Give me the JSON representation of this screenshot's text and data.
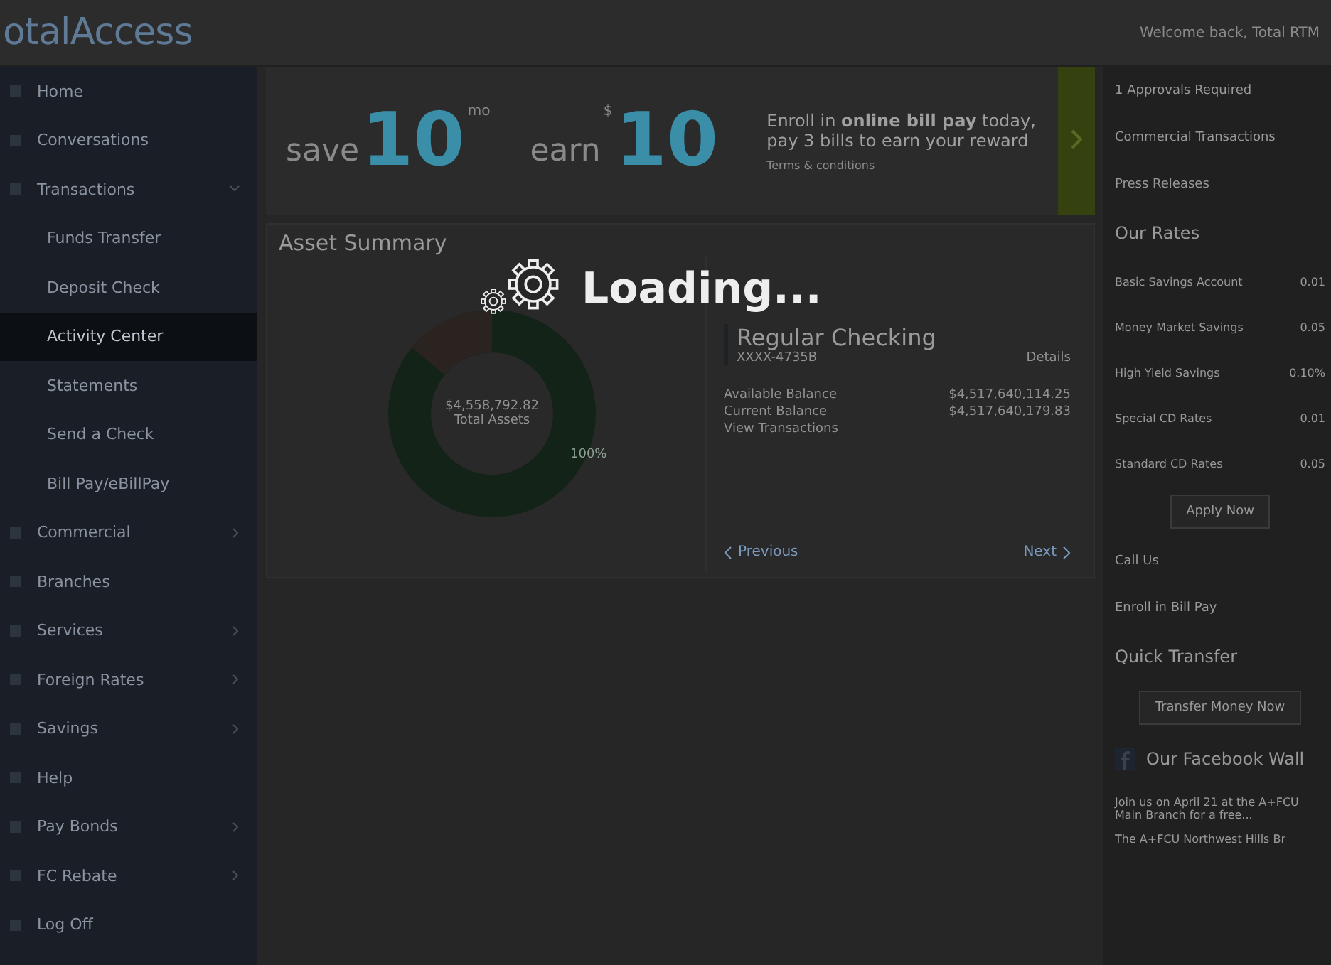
{
  "header": {
    "logo": "otalAccess",
    "welcome": "Welcome back, Total RTM"
  },
  "sidebar": {
    "items": [
      {
        "label": "Home",
        "kind": "top",
        "selected": false
      },
      {
        "label": "Conversations",
        "kind": "top",
        "selected": false
      },
      {
        "label": "Transactions",
        "kind": "group",
        "expanded": true,
        "selected": false
      },
      {
        "label": "Funds Transfer",
        "kind": "sub",
        "selected": false
      },
      {
        "label": "Deposit Check",
        "kind": "sub",
        "selected": false
      },
      {
        "label": "Activity Center",
        "kind": "sub",
        "selected": true
      },
      {
        "label": "Statements",
        "kind": "sub",
        "selected": false
      },
      {
        "label": "Send a Check",
        "kind": "sub",
        "selected": false
      },
      {
        "label": "Bill Pay/eBillPay",
        "kind": "sub",
        "selected": false
      },
      {
        "label": "Commercial",
        "kind": "group",
        "expanded": false,
        "selected": false
      },
      {
        "label": "Branches",
        "kind": "top",
        "selected": false
      },
      {
        "label": "Services",
        "kind": "group",
        "expanded": false,
        "selected": false
      },
      {
        "label": "Foreign Rates",
        "kind": "group",
        "expanded": false,
        "selected": false
      },
      {
        "label": "Savings",
        "kind": "group",
        "expanded": false,
        "selected": false
      },
      {
        "label": "Help",
        "kind": "top",
        "selected": false
      },
      {
        "label": "Pay Bonds",
        "kind": "group",
        "expanded": false,
        "selected": false
      },
      {
        "label": "FC Rebate",
        "kind": "group",
        "expanded": false,
        "selected": false
      },
      {
        "label": "Log Off",
        "kind": "top",
        "selected": false
      }
    ]
  },
  "banner": {
    "save_word": "save",
    "save_amount": "10",
    "save_unit": "mo",
    "earn_word": "earn",
    "earn_currency": "$",
    "earn_amount": "10",
    "message": "Enroll in **online bill pay** today, pay 3 bills to earn your reward",
    "terms": "Terms & conditions"
  },
  "asset_summary": {
    "title": "Asset Summary",
    "donut_total": "$4,558,792.82",
    "donut_caption": "Total Assets",
    "donut_share": "100%",
    "account": {
      "name": "Regular Checking",
      "number": "XXXX-4735B",
      "link": "Details",
      "rows": [
        {
          "label": "Available Balance",
          "value": "$4,517,640,114.25"
        },
        {
          "label": "Current Balance",
          "value": "$4,517,640,179.83"
        }
      ],
      "transactions_link": "View Transactions",
      "previous": "Previous",
      "next": "Next"
    }
  },
  "right": {
    "links": [
      "1 Approvals Required",
      "Commercial Transactions",
      "Press Releases"
    ],
    "rates_title": "Our Rates",
    "rates": [
      {
        "name": "Basic Savings Account",
        "value": "0.01"
      },
      {
        "name": "Money Market Savings",
        "value": "0.05"
      },
      {
        "name": "High Yield Savings",
        "value": "0.10%"
      },
      {
        "name": "Special CD Rates",
        "value": "0.01"
      },
      {
        "name": "Standard CD Rates",
        "value": "0.05"
      }
    ],
    "apply": "Apply Now",
    "more_links": [
      "Call Us",
      "Enroll in Bill Pay"
    ],
    "quick_title": "Quick Transfer",
    "transfer": "Transfer Money Now",
    "facebook_title": "Our Facebook Wall",
    "posts": [
      "Join us on April 21 at the A+FCU Main Branch for a free...",
      "The A+FCU Northwest Hills Br"
    ]
  },
  "loading": {
    "text": "Loading..."
  }
}
